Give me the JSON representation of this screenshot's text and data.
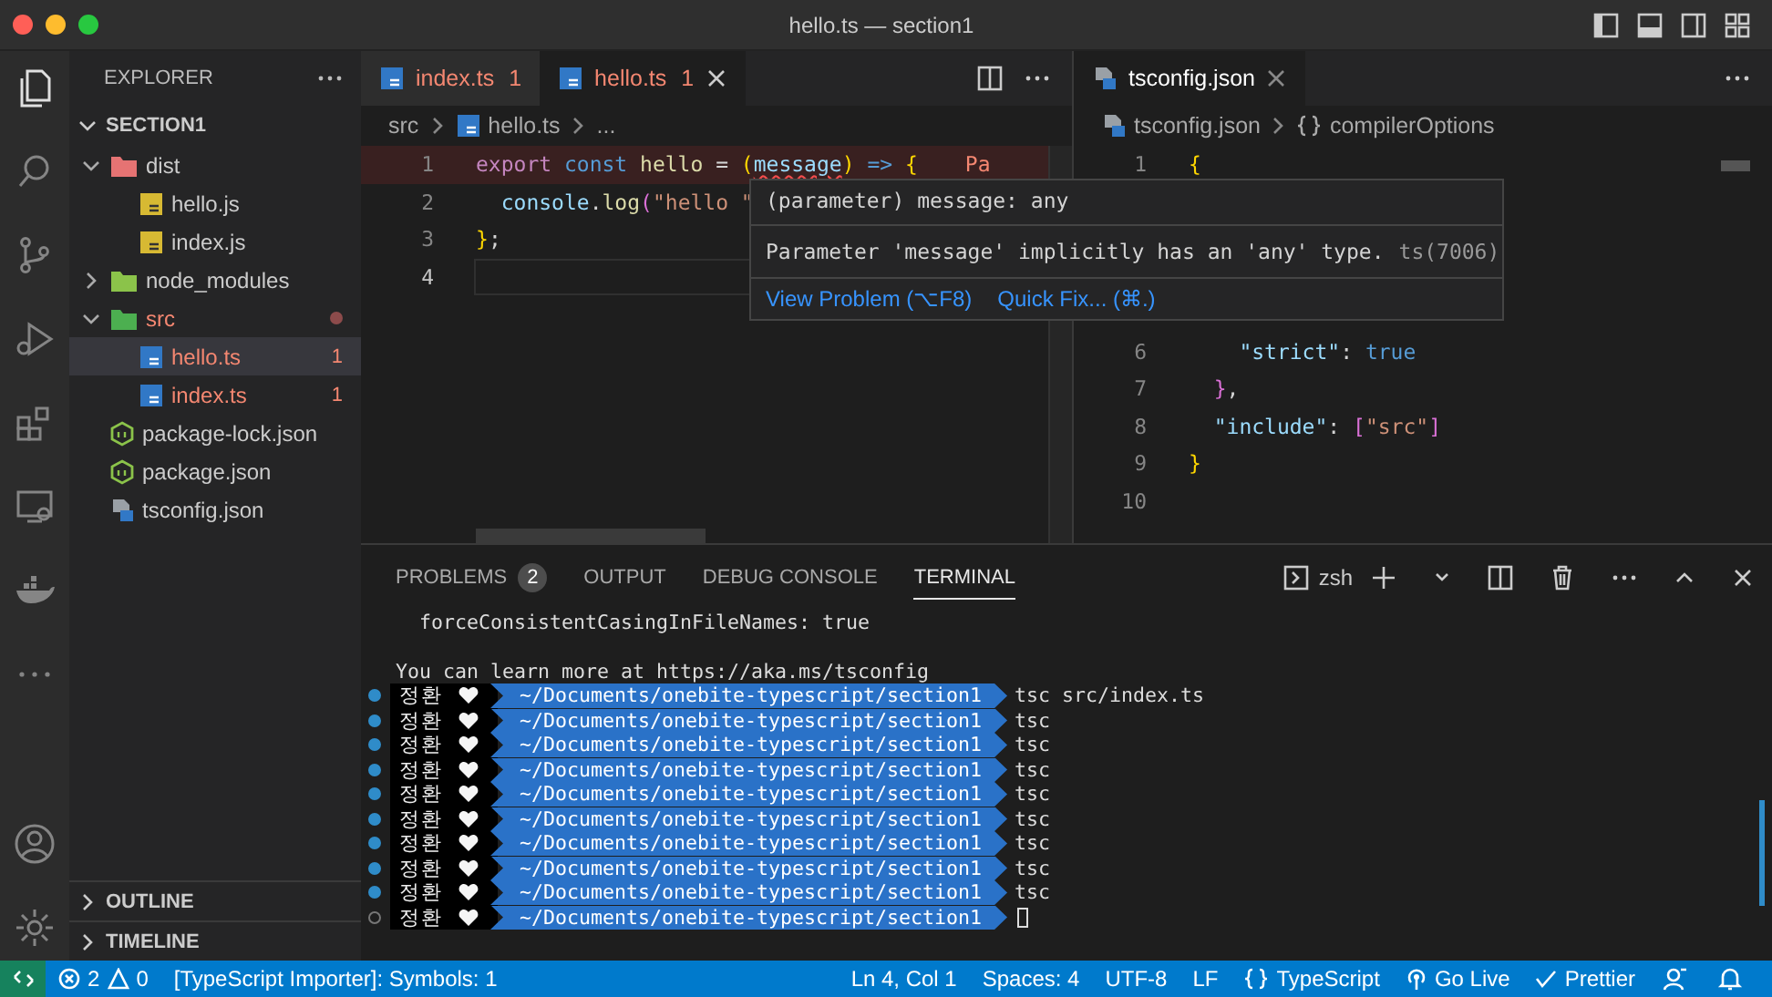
{
  "window": {
    "title": "hello.ts — section1"
  },
  "sidebar": {
    "title": "EXPLORER",
    "section": "SECTION1",
    "tree": [
      {
        "label": "dist",
        "kind": "folder",
        "expanded": true,
        "has_problems": false,
        "selected": false,
        "children": [
          {
            "label": "hello.js",
            "kind": "js",
            "selected": false,
            "has_problems": false
          },
          {
            "label": "index.js",
            "kind": "js",
            "selected": false,
            "has_problems": false
          }
        ]
      },
      {
        "label": "node_modules",
        "kind": "folder",
        "expanded": false,
        "has_problems": false,
        "selected": false
      },
      {
        "label": "src",
        "kind": "folder",
        "expanded": true,
        "has_problems": true,
        "selected": false,
        "children": [
          {
            "label": "hello.ts",
            "kind": "ts",
            "selected": true,
            "has_problems": true,
            "errors": "1"
          },
          {
            "label": "index.ts",
            "kind": "ts",
            "selected": false,
            "has_problems": true,
            "errors": "1"
          }
        ]
      },
      {
        "label": "package-lock.json",
        "kind": "npm",
        "selected": false,
        "has_problems": false
      },
      {
        "label": "package.json",
        "kind": "npm",
        "selected": false,
        "has_problems": false
      },
      {
        "label": "tsconfig.json",
        "kind": "tsconfig",
        "selected": false,
        "has_problems": false
      }
    ],
    "footer_sections": [
      "OUTLINE",
      "TIMELINE"
    ]
  },
  "left_editor": {
    "tabs": [
      {
        "label": "index.ts",
        "errors": "1",
        "selected": false
      },
      {
        "label": "hello.ts",
        "errors": "1",
        "selected": true
      }
    ],
    "breadcrumb": [
      "src",
      "hello.ts",
      "..."
    ],
    "lines": [
      {
        "number": "1",
        "current": false,
        "tokens": [
          {
            "text": "export ",
            "kind": "keyword"
          },
          {
            "text": "const ",
            "kind": "storage"
          },
          {
            "text": "hello",
            "kind": "func"
          },
          {
            "text": " = ",
            "kind": "plain"
          },
          {
            "text": "(",
            "kind": "bracket"
          },
          {
            "text": "message",
            "kind": "error"
          },
          {
            "text": ")",
            "kind": "bracket"
          },
          {
            "text": " => ",
            "kind": "storage"
          },
          {
            "text": "{",
            "kind": "bracket"
          }
        ],
        "inline_hint": "Pa"
      },
      {
        "number": "2",
        "current": false,
        "tokens": [
          {
            "text": "  console",
            "kind": "var"
          },
          {
            "text": ".",
            "kind": "plain"
          },
          {
            "text": "log",
            "kind": "func"
          },
          {
            "text": "(",
            "kind": "bracket2"
          },
          {
            "text": "\"hello \"",
            "kind": "string"
          }
        ]
      },
      {
        "number": "3",
        "current": false,
        "tokens": [
          {
            "text": "}",
            "kind": "bracket"
          },
          {
            "text": ";",
            "kind": "plain"
          }
        ]
      },
      {
        "number": "4",
        "current": true
      }
    ]
  },
  "hover": {
    "signature": "(parameter) message: any",
    "message": "Parameter 'message' implicitly has an 'any' type.",
    "code": "ts(7006)",
    "actions": [
      "View Problem (⌥F8)",
      "Quick Fix... (⌘.)"
    ]
  },
  "right_editor": {
    "tabs": [
      {
        "label": "tsconfig.json",
        "selected": true
      }
    ],
    "breadcrumb": [
      "tsconfig.json",
      "compilerOptions"
    ],
    "lines": [
      {
        "number": "1",
        "tokens": [
          {
            "text": "{",
            "kind": "bracket"
          }
        ]
      },
      {
        "number": "6",
        "tokens": [
          {
            "text": "    \"strict\"",
            "kind": "var"
          },
          {
            "text": ": ",
            "kind": "plain"
          },
          {
            "text": "true",
            "kind": "storage"
          }
        ]
      },
      {
        "number": "7",
        "tokens": [
          {
            "text": "  }",
            "kind": "bracket2"
          },
          {
            "text": ",",
            "kind": "plain"
          }
        ]
      },
      {
        "number": "8",
        "tokens": [
          {
            "text": "  \"include\"",
            "kind": "var"
          },
          {
            "text": ": ",
            "kind": "plain"
          },
          {
            "text": "[",
            "kind": "bracket2"
          },
          {
            "text": "\"src\"",
            "kind": "string"
          },
          {
            "text": "]",
            "kind": "bracket2"
          }
        ]
      },
      {
        "number": "9",
        "tokens": [
          {
            "text": "}",
            "kind": "bracket"
          }
        ]
      },
      {
        "number": "10"
      }
    ]
  },
  "panel": {
    "tabs": [
      {
        "label": "PROBLEMS",
        "badge": "2",
        "selected": false
      },
      {
        "label": "OUTPUT",
        "selected": false
      },
      {
        "label": "DEBUG CONSOLE",
        "selected": false
      },
      {
        "label": "TERMINAL",
        "selected": true
      }
    ],
    "shell": "zsh",
    "output": [
      "  forceConsistentCasingInFileNames: true",
      "You can learn more at https://aka.ms/tsconfig"
    ],
    "prompts": [
      {
        "done": true,
        "user": "정환",
        "path": "~/Documents/onebite-typescript/section1",
        "command": "tsc src/index.ts"
      },
      {
        "done": true,
        "user": "정환",
        "path": "~/Documents/onebite-typescript/section1",
        "command": "tsc"
      },
      {
        "done": true,
        "user": "정환",
        "path": "~/Documents/onebite-typescript/section1",
        "command": "tsc"
      },
      {
        "done": true,
        "user": "정환",
        "path": "~/Documents/onebite-typescript/section1",
        "command": "tsc"
      },
      {
        "done": true,
        "user": "정환",
        "path": "~/Documents/onebite-typescript/section1",
        "command": "tsc"
      },
      {
        "done": true,
        "user": "정환",
        "path": "~/Documents/onebite-typescript/section1",
        "command": "tsc"
      },
      {
        "done": true,
        "user": "정환",
        "path": "~/Documents/onebite-typescript/section1",
        "command": "tsc"
      },
      {
        "done": true,
        "user": "정환",
        "path": "~/Documents/onebite-typescript/section1",
        "command": "tsc"
      },
      {
        "done": true,
        "user": "정환",
        "path": "~/Documents/onebite-typescript/section1",
        "command": "tsc"
      },
      {
        "done": false,
        "user": "정환",
        "path": "~/Documents/onebite-typescript/section1",
        "cursor": true
      }
    ]
  },
  "status_bar": {
    "errors": "2",
    "warnings": "0",
    "message": "[TypeScript Importer]: Symbols: 1",
    "right": [
      {
        "kind": "text",
        "label": "Ln 4, Col 1"
      },
      {
        "kind": "text",
        "label": "Spaces: 4"
      },
      {
        "kind": "text",
        "label": "UTF-8"
      },
      {
        "kind": "text",
        "label": "LF"
      },
      {
        "kind": "language",
        "label": "TypeScript"
      },
      {
        "kind": "golive",
        "label": "Go Live"
      },
      {
        "kind": "prettier",
        "label": "Prettier"
      },
      {
        "kind": "feedback"
      },
      {
        "kind": "bell"
      }
    ]
  }
}
